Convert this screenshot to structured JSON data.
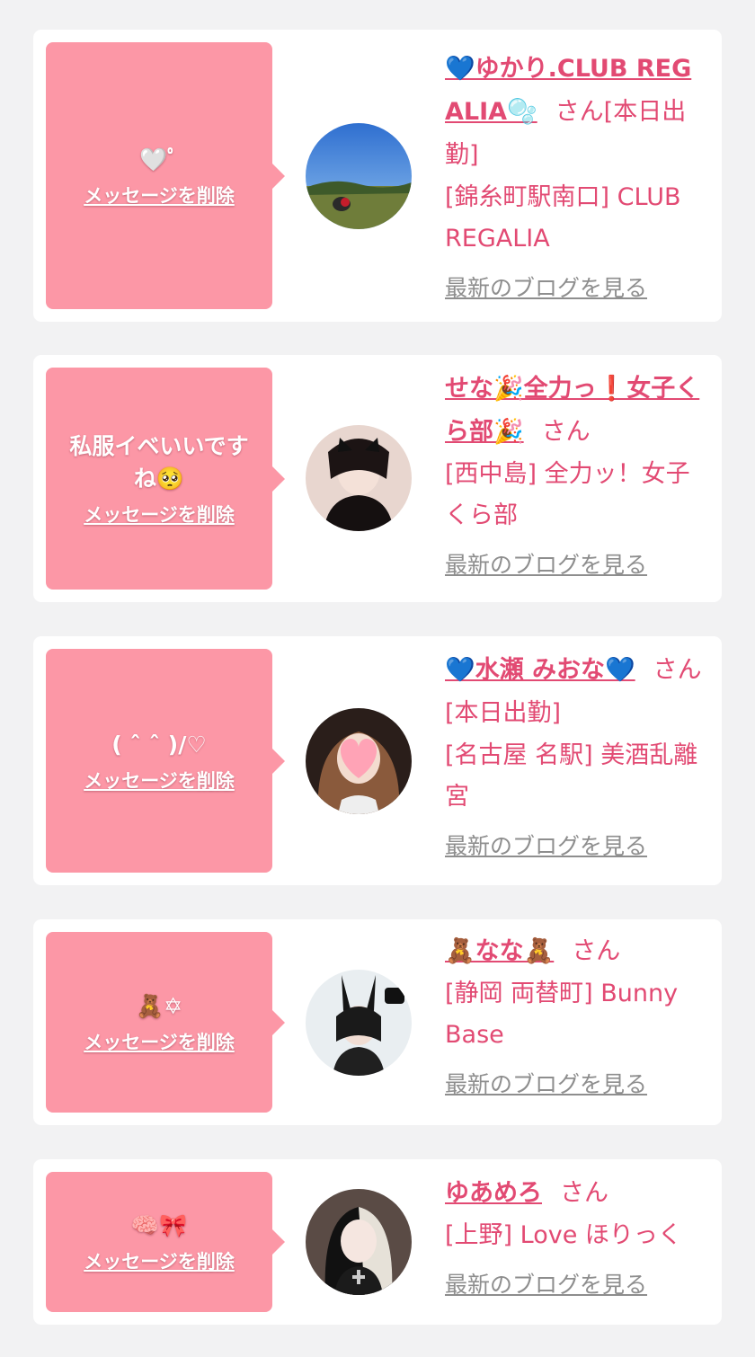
{
  "messages": [
    {
      "message": "🤍ﾟ",
      "delete_label": "メッセージを削除",
      "name": "💙ゆかり.CLUB REGALIA🫧",
      "honorific": "さん",
      "status": "[本日出勤]",
      "shop": "[錦糸町駅南口] CLUB REGALIA",
      "blog_label": "最新のブログを見る"
    },
    {
      "message": "私服イベいいですね🥺",
      "delete_label": "メッセージを削除",
      "name": "せな🎉全力っ❗女子くら部🎉",
      "honorific": "さん",
      "status": "",
      "shop": "[西中島] 全力ッ！女子くら部",
      "blog_label": "最新のブログを見る"
    },
    {
      "message": "( ˆ ˆ )/♡",
      "delete_label": "メッセージを削除",
      "name": "💙水瀬 みおな💙",
      "honorific": "さん",
      "status": "[本日出勤]",
      "shop": "[名古屋 名駅] 美酒乱離宮",
      "blog_label": "最新のブログを見る"
    },
    {
      "message": "🧸✡",
      "delete_label": "メッセージを削除",
      "name": "🧸なな🧸",
      "honorific": "さん",
      "status": "",
      "shop": "[静岡 両替町] Bunny Base",
      "blog_label": "最新のブログを見る"
    },
    {
      "message": "🧠🎀",
      "delete_label": "メッセージを削除",
      "name": "ゆあめろ",
      "honorific": "さん",
      "status": "",
      "shop": "[上野] Love ほりっく",
      "blog_label": "最新のブログを見る"
    }
  ],
  "colors": {
    "page_bg": "#f2f2f3",
    "card_bg": "#ffffff",
    "bubble": "#fc97a6",
    "accent": "#e24a73",
    "muted_link": "#8e8e8e"
  }
}
